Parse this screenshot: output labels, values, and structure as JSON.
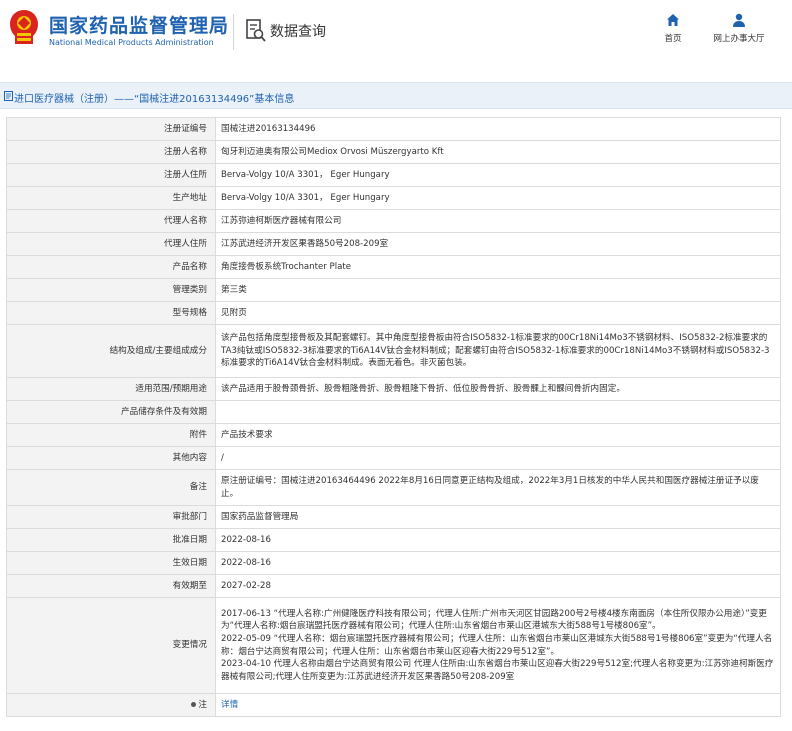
{
  "header": {
    "brand_cn": "国家药品监督管理局",
    "brand_en": "National Medical Products Administration",
    "query_title": "数据查询",
    "nav_home": "首页",
    "nav_service": "网上办事大厅"
  },
  "breadcrumb": {
    "text": "进口医疗器械（注册）——“国械注进20163134496”基本信息"
  },
  "rows": [
    {
      "label": "注册证编号",
      "value": "国械注进20163134496"
    },
    {
      "label": "注册人名称",
      "value": "匈牙利迈迪奥有限公司Mediox Orvosi Müszergyarto Kft"
    },
    {
      "label": "注册人住所",
      "value": "Berva-Volgy 10/A 3301， Eger Hungary"
    },
    {
      "label": "生产地址",
      "value": "Berva-Volgy 10/A 3301， Eger Hungary"
    },
    {
      "label": "代理人名称",
      "value": "江苏弥迪柯斯医疗器械有限公司"
    },
    {
      "label": "代理人住所",
      "value": "江苏武进经济开发区果香路50号208-209室"
    },
    {
      "label": "产品名称",
      "value": "角度接骨板系统Trochanter Plate"
    },
    {
      "label": "管理类别",
      "value": "第三类"
    },
    {
      "label": "型号规格",
      "value": "见附页"
    },
    {
      "label": "结构及组成/主要组成成分",
      "value": "该产品包括角度型接骨板及其配套螺钉。其中角度型接骨板由符合ISO5832-1标准要求的00Cr18Ni14Mo3不锈钢材料、ISO5832-2标准要求的TA3纯钛或ISO5832-3标准要求的Ti6A14V钛合金材料制成；配套螺钉由符合ISO5832-1标准要求的00Cr18Ni14Mo3不锈钢材料或ISO5832-3标准要求的Ti6A14V钛合金材料制成。表面无着色。非灭菌包装。"
    },
    {
      "label": "适用范围/预期用途",
      "value": "该产品适用于股骨颈骨折、股骨粗隆骨折、股骨粗隆下骨折、低位股骨骨折、股骨髁上和髁间骨折内固定。"
    },
    {
      "label": "产品储存条件及有效期",
      "value": ""
    },
    {
      "label": "附件",
      "value": "产品技术要求"
    },
    {
      "label": "其他内容",
      "value": "/"
    },
    {
      "label": "备注",
      "value": "原注册证编号：国械注进20163464496 2022年8月16日同意更正结构及组成，2022年3月1日核发的中华人民共和国医疗器械注册证予以废止。"
    },
    {
      "label": "审批部门",
      "value": "国家药品监督管理局"
    },
    {
      "label": "批准日期",
      "value": "2022-08-16"
    },
    {
      "label": "生效日期",
      "value": "2022-08-16"
    },
    {
      "label": "有效期至",
      "value": "2027-02-28"
    }
  ],
  "change": {
    "label": "变更情况",
    "lines": [
      "2017-06-13 “代理人名称:广州健隆医疗科技有限公司；代理人住所:广州市天河区甘园路200号2号楼4楼东南面房（本住所仅限办公用途）”变更为“代理人名称:烟台宸瑞盟托医疗器械有限公司；代理人住所:山东省烟台市莱山区港城东大街588号1号楼806室”。",
      "2022-05-09 “代理人名称：烟台宸瑞盟托医疗器械有限公司；代理人住所：山东省烟台市莱山区港城东大街588号1号楼806室”变更为“代理人名称：烟台宁达商贸有限公司；代理人住所：山东省烟台市莱山区迎春大街229号512室”。",
      "2023-04-10 代理人名称由烟台宁达商贸有限公司 代理人住所由:山东省烟台市莱山区迎春大街229号512室;代理人名称变更为:江苏弥迪柯斯医疗器械有限公司;代理人住所变更为:江苏武进经济开发区果香路50号208-209室"
    ]
  },
  "note": {
    "label": "注",
    "link": "详情"
  },
  "colors": {
    "brand_blue": "#1e62b0",
    "logo_red": "#d9251d",
    "label_bg": "#f3f3f3",
    "breadcrumb_bg": "#eaf1f9"
  }
}
